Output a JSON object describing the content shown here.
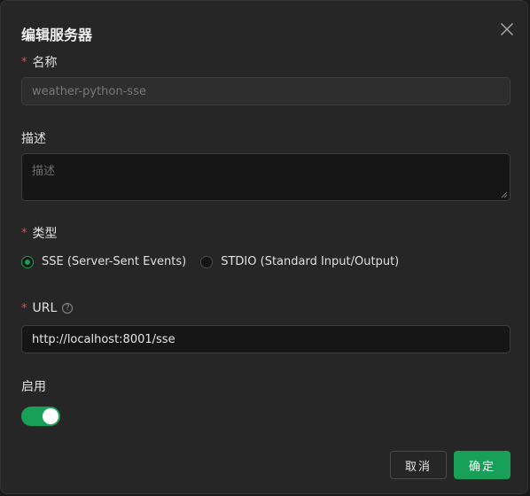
{
  "dialog": {
    "title": "编辑服务器",
    "close_icon": "close-icon"
  },
  "form": {
    "name": {
      "required": "*",
      "label": "名称",
      "value": "weather-python-sse"
    },
    "description": {
      "label": "描述",
      "placeholder": "描述"
    },
    "type": {
      "required": "*",
      "label": "类型",
      "options": [
        {
          "label": "SSE (Server-Sent Events)",
          "selected": true
        },
        {
          "label": "STDIO (Standard Input/Output)",
          "selected": false
        }
      ]
    },
    "url": {
      "required": "*",
      "label": "URL",
      "help_icon": "question-circle-icon",
      "help_glyph": "?",
      "value": "http://localhost:8001/sse"
    },
    "enabled": {
      "label": "启用",
      "on": true
    }
  },
  "footer": {
    "cancel_label": "取消",
    "ok_label": "确定"
  },
  "colors": {
    "accent": "#18a058",
    "required": "#e5484d",
    "background": "#262626"
  }
}
